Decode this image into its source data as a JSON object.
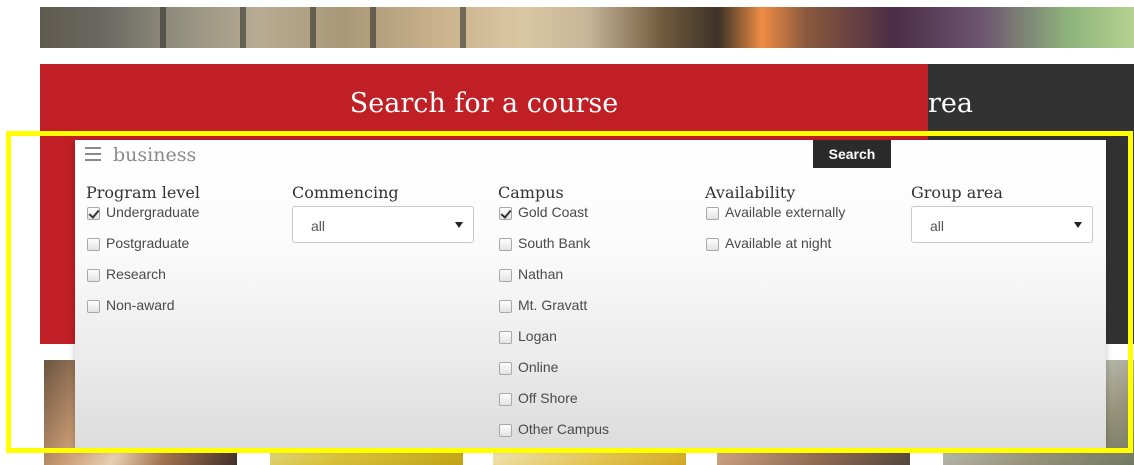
{
  "header": {
    "title": "Search for a course",
    "side_title": "rea"
  },
  "search": {
    "query": "business",
    "button_label": "Search"
  },
  "filters": {
    "program_level": {
      "title": "Program level",
      "options": [
        {
          "label": "Undergraduate",
          "checked": true
        },
        {
          "label": "Postgraduate",
          "checked": false
        },
        {
          "label": "Research",
          "checked": false
        },
        {
          "label": "Non-award",
          "checked": false
        }
      ]
    },
    "commencing": {
      "title": "Commencing",
      "selected": "all"
    },
    "campus": {
      "title": "Campus",
      "options": [
        {
          "label": "Gold Coast",
          "checked": true
        },
        {
          "label": "South Bank",
          "checked": false
        },
        {
          "label": "Nathan",
          "checked": false
        },
        {
          "label": "Mt. Gravatt",
          "checked": false
        },
        {
          "label": "Logan",
          "checked": false
        },
        {
          "label": "Online",
          "checked": false
        },
        {
          "label": "Off Shore",
          "checked": false
        },
        {
          "label": "Other Campus",
          "checked": false
        }
      ]
    },
    "availability": {
      "title": "Availability",
      "options": [
        {
          "label": "Available externally",
          "checked": false
        },
        {
          "label": "Available at night",
          "checked": false
        }
      ]
    },
    "group_area": {
      "title": "Group area",
      "selected": "all"
    }
  },
  "colors": {
    "brand_red": "#c01f25",
    "dark_band": "#323232",
    "search_button": "#2b2b2b",
    "highlight": "#ffff00"
  }
}
